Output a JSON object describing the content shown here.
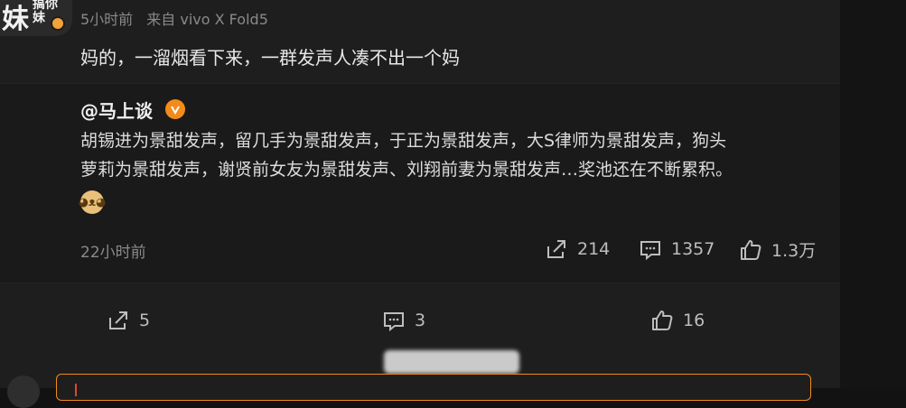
{
  "post": {
    "avatar_text_big": "妹",
    "avatar_text_small": "搞你\n妹",
    "time": "5小时前",
    "source": "来自 vivo X Fold5",
    "text": "妈的，一溜烟看下来，一群发声人凑不出一个妈"
  },
  "repost": {
    "author": "@马上谈",
    "text_line1": "胡锡进为景甜发声，留几手为景甜发声，于正为景甜发声，大S律师为景甜发声，狗头",
    "text_line2": "萝莉为景甜发声，谢贤前女友为景甜发声、刘翔前妻为景甜发声…奖池还在不断累积。",
    "time": "22小时前",
    "share_count": "214",
    "comment_count": "1357",
    "like_count": "1.3万"
  },
  "actions": {
    "share_count": "5",
    "comment_count": "3",
    "like_count": "16"
  },
  "colors": {
    "accent": "#f38b1a",
    "background": "#1e1e1e",
    "muted_text": "#8a8a8a"
  }
}
